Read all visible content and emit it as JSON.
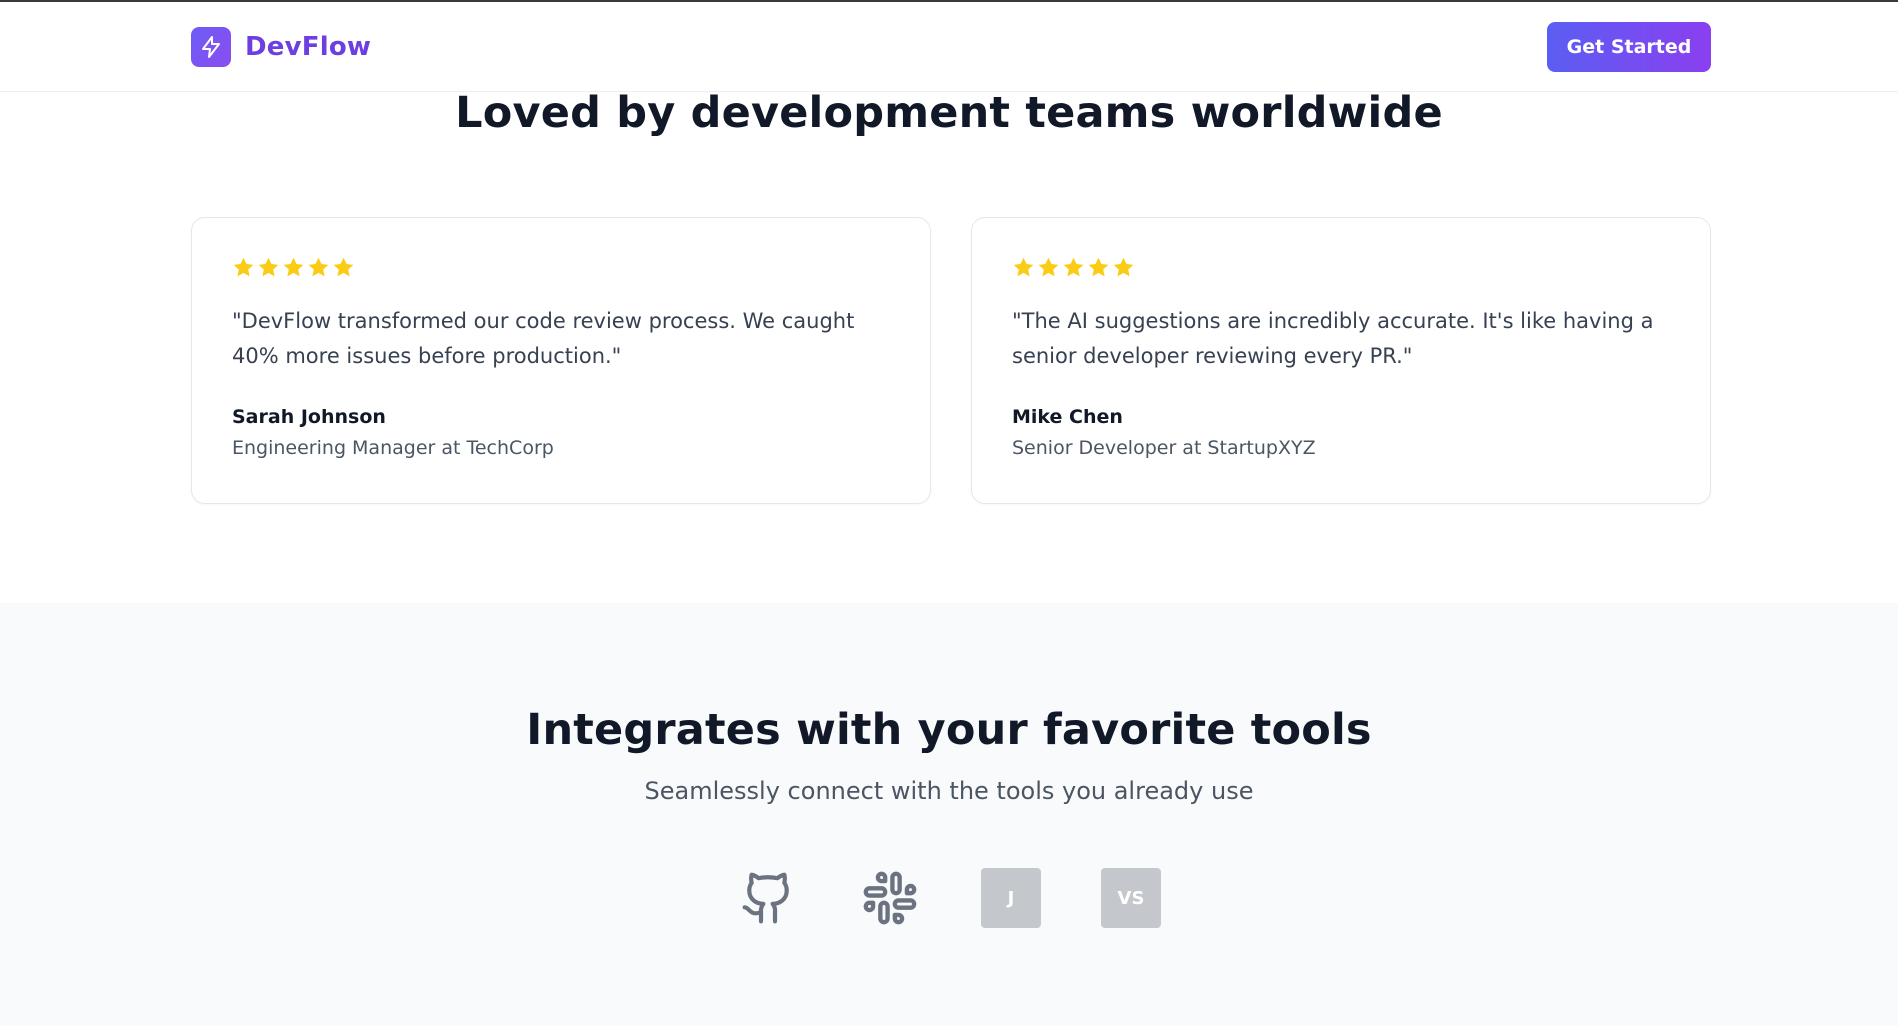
{
  "nav": {
    "brand": "DevFlow",
    "cta_label": "Get Started"
  },
  "testimonials": {
    "title": "Loved by development teams worldwide",
    "items": [
      {
        "rating": 5,
        "quote": "\"DevFlow transformed our code review process. We caught 40% more issues before production.\"",
        "name": "Sarah Johnson",
        "role": "Engineering Manager at TechCorp"
      },
      {
        "rating": 5,
        "quote": "\"The AI suggestions are incredibly accurate. It's like having a senior developer reviewing every PR.\"",
        "name": "Mike Chen",
        "role": "Senior Developer at StartupXYZ"
      }
    ]
  },
  "integrations": {
    "title": "Integrates with your favorite tools",
    "subtitle": "Seamlessly connect with the tools you already use",
    "tools": [
      {
        "icon": "github-icon"
      },
      {
        "icon": "slack-icon"
      },
      {
        "icon": "jira-icon",
        "label": "J"
      },
      {
        "icon": "vscode-icon",
        "label": "VS"
      }
    ]
  },
  "colors": {
    "brand": "#6d3fe0",
    "cta_gradient_start": "#5b5ef2",
    "cta_gradient_end": "#8b3ff0",
    "star": "#facc15",
    "tool_icon": "#6b7280",
    "tool_box": "#c4c7cc",
    "section_bg": "#f9fafb"
  }
}
